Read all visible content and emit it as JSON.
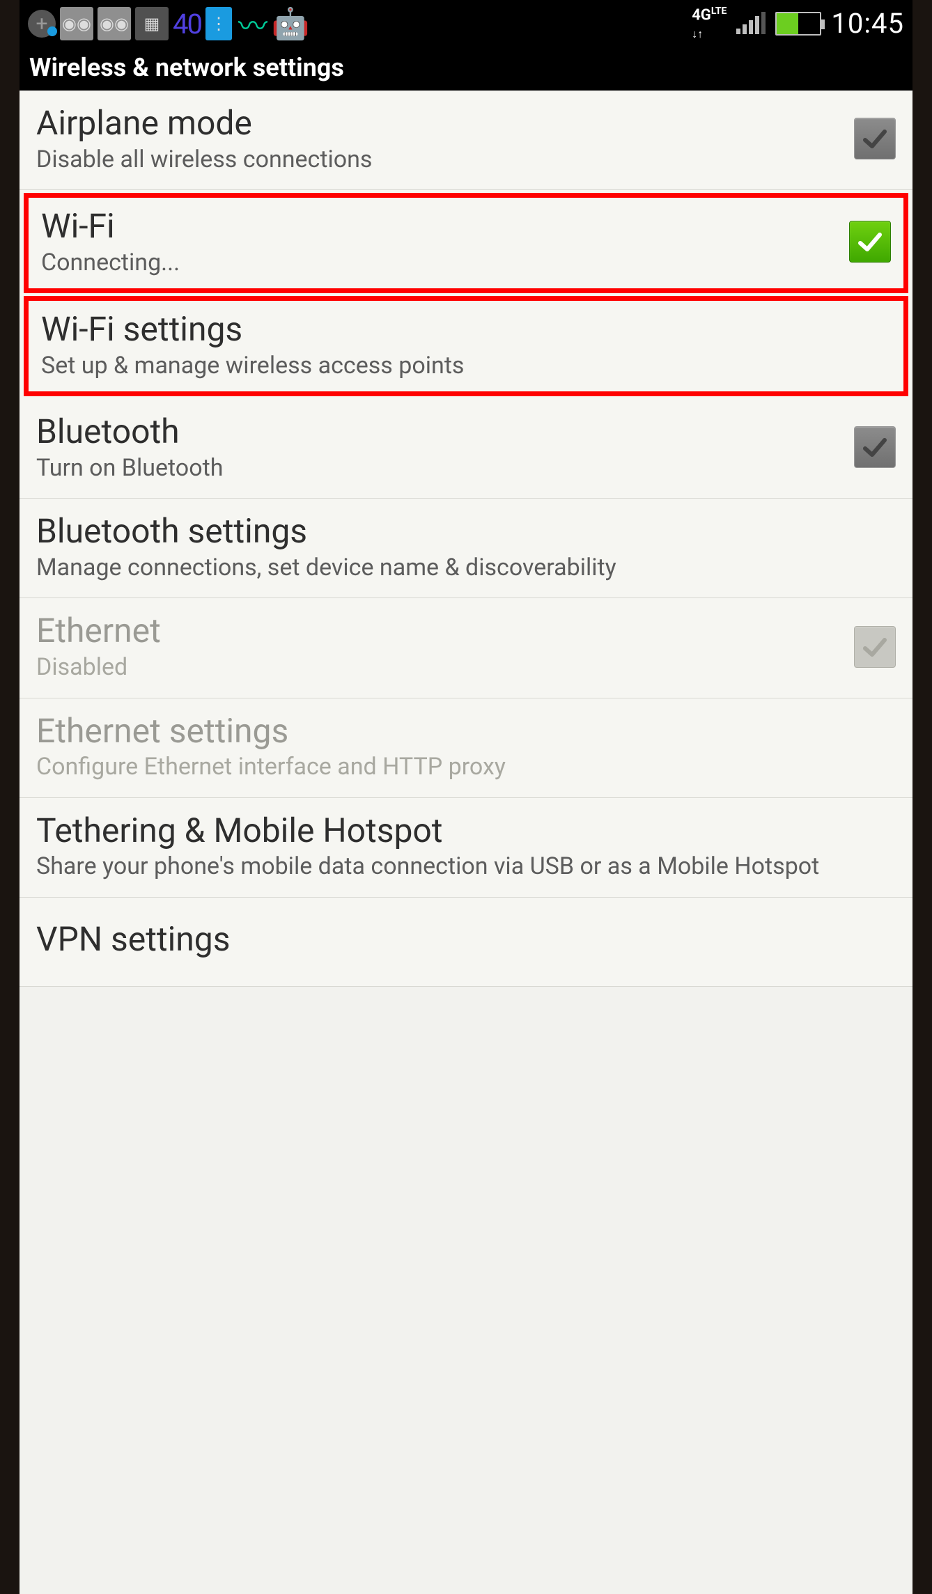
{
  "status_bar": {
    "number": "40",
    "net_label": "4G LTE",
    "clock": "10:45"
  },
  "page_title": "Wireless & network settings",
  "items": [
    {
      "title": "Airplane mode",
      "subtitle": "Disable all wireless connections",
      "has_checkbox": true,
      "checked": false,
      "disabled": false,
      "highlighted": false
    },
    {
      "title": "Wi-Fi",
      "subtitle": "Connecting...",
      "has_checkbox": true,
      "checked": true,
      "disabled": false,
      "highlighted": true
    },
    {
      "title": "Wi-Fi settings",
      "subtitle": "Set up & manage wireless access points",
      "has_checkbox": false,
      "checked": false,
      "disabled": false,
      "highlighted": true
    },
    {
      "title": "Bluetooth",
      "subtitle": "Turn on Bluetooth",
      "has_checkbox": true,
      "checked": false,
      "disabled": false,
      "highlighted": false
    },
    {
      "title": "Bluetooth settings",
      "subtitle": "Manage connections, set device name & discoverability",
      "has_checkbox": false,
      "checked": false,
      "disabled": false,
      "highlighted": false
    },
    {
      "title": "Ethernet",
      "subtitle": "Disabled",
      "has_checkbox": true,
      "checked": false,
      "disabled": true,
      "highlighted": false
    },
    {
      "title": "Ethernet settings",
      "subtitle": "Configure Ethernet interface and HTTP proxy",
      "has_checkbox": false,
      "checked": false,
      "disabled": true,
      "highlighted": false
    },
    {
      "title": "Tethering & Mobile Hotspot",
      "subtitle": "Share your phone's mobile data connection via USB or as a Mobile Hotspot",
      "has_checkbox": false,
      "checked": false,
      "disabled": false,
      "highlighted": false
    },
    {
      "title": "VPN settings",
      "subtitle": "",
      "has_checkbox": false,
      "checked": false,
      "disabled": false,
      "highlighted": false
    }
  ]
}
